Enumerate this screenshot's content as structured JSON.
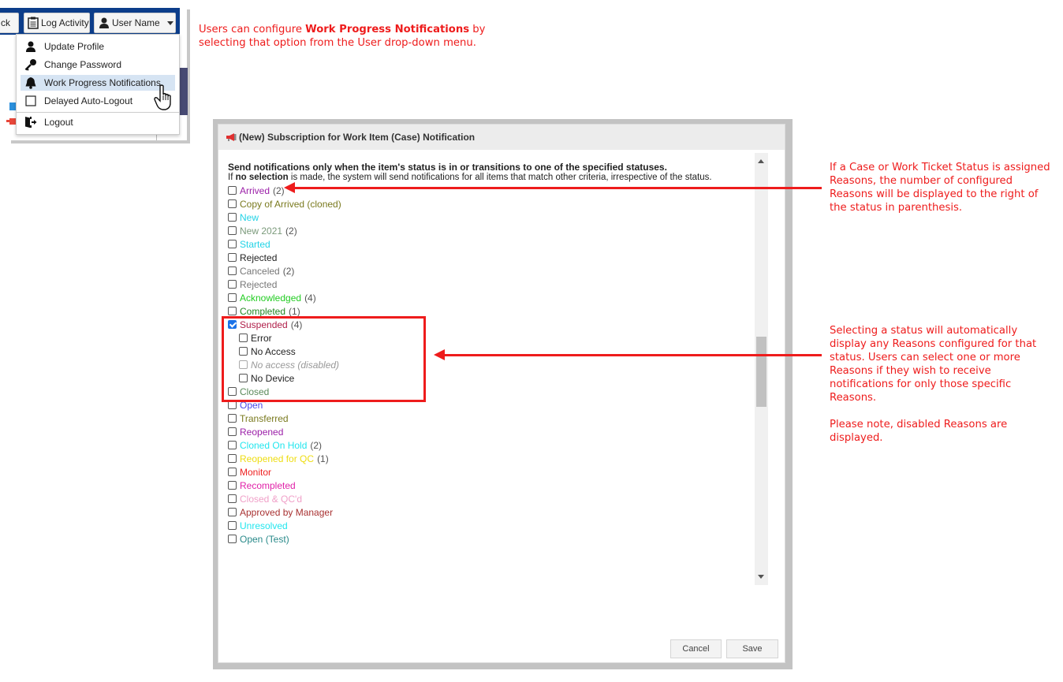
{
  "app": {
    "toolbar": {
      "back_label": "ck",
      "log_activity_label": "Log Activity",
      "user_menu_label": "User Name"
    },
    "user_menu": {
      "items": [
        {
          "label": "Update Profile",
          "icon": "user-icon"
        },
        {
          "label": "Change Password",
          "icon": "key-icon"
        },
        {
          "label": "Work Progress Notifications",
          "icon": "bell-icon",
          "active": true
        },
        {
          "label": "Delayed Auto-Logout",
          "icon": "checkbox-icon"
        },
        {
          "label": "Logout",
          "icon": "logout-icon"
        }
      ]
    }
  },
  "annotations": {
    "note1_pre": "Users can configure ",
    "note1_bold": "Work Progress Notifications",
    "note1_post": " by selecting that option from the User drop-down menu.",
    "note2": "If a Case or Work Ticket Status is assigned Reasons, the number of configured Reasons will be displayed to the right of the status in parenthesis.",
    "note3_p1": "Selecting a status will automatically display any Reasons configured for that status. Users can select one or more Reasons if they wish to receive notifications for only those specific Reasons.",
    "note3_p2": "Please note, disabled Reasons are displayed.",
    "accent_color": "#ee1c1c"
  },
  "dialog": {
    "title": "(New) Subscription for Work Item (Case) Notification",
    "intro_bold": "Send notifications only when the item's status is in or transitions to one of the specified statuses.",
    "intro_pre": "If ",
    "intro_b": "no selection",
    "intro_post": " is made, the system will send notifications for all items that match other criteria, irrespective of the status.",
    "statuses": [
      {
        "label": "Arrived",
        "count": "(2)",
        "color": "#9b1fa8",
        "checked": false
      },
      {
        "label": "Copy of Arrived (cloned)",
        "count": "",
        "color": "#7a7a1f",
        "checked": false
      },
      {
        "label": "New",
        "count": "",
        "color": "#22d3e6",
        "checked": false
      },
      {
        "label": "New 2021",
        "count": "(2)",
        "color": "#7b9a7b",
        "checked": false
      },
      {
        "label": "Started",
        "count": "",
        "color": "#22d3e6",
        "checked": false
      },
      {
        "label": "Rejected",
        "count": "",
        "color": "#222222",
        "checked": false
      },
      {
        "label": "Canceled",
        "count": "(2)",
        "color": "#777777",
        "checked": false
      },
      {
        "label": "Rejected",
        "count": "",
        "color": "#777777",
        "checked": false
      },
      {
        "label": "Acknowledged",
        "count": "(4)",
        "color": "#22cc22",
        "checked": false
      },
      {
        "label": "Completed",
        "count": "(1)",
        "color": "#228822",
        "checked": false
      },
      {
        "label": "Suspended",
        "count": "(4)",
        "color": "#b0204a",
        "checked": true,
        "reasons": [
          {
            "label": "Error",
            "disabled": false,
            "checked": false
          },
          {
            "label": "No Access",
            "disabled": false,
            "checked": false
          },
          {
            "label": "No access (disabled)",
            "disabled": true,
            "checked": false
          },
          {
            "label": "No Device",
            "disabled": false,
            "checked": false
          }
        ]
      },
      {
        "label": "Closed",
        "count": "",
        "color": "#5a8a5a",
        "checked": false
      },
      {
        "label": "Open",
        "count": "",
        "color": "#4a4ae8",
        "checked": false
      },
      {
        "label": "Transferred",
        "count": "",
        "color": "#7a7a1f",
        "checked": false
      },
      {
        "label": "Reopened",
        "count": "",
        "color": "#9b1fa8",
        "checked": false
      },
      {
        "label": "Cloned On Hold",
        "count": "(2)",
        "color": "#22e6ee",
        "checked": false
      },
      {
        "label": "Reopened for QC",
        "count": "(1)",
        "color": "#eedd11",
        "checked": false
      },
      {
        "label": "Monitor",
        "count": "",
        "color": "#ee2222",
        "checked": false
      },
      {
        "label": "Recompleted",
        "count": "",
        "color": "#e022a8",
        "checked": false
      },
      {
        "label": "Closed & QC'd",
        "count": "",
        "color": "#f0a0c8",
        "checked": false
      },
      {
        "label": "Approved by Manager",
        "count": "",
        "color": "#a83232",
        "checked": false
      },
      {
        "label": "Unresolved",
        "count": "",
        "color": "#22e6ee",
        "checked": false
      },
      {
        "label": "Open (Test)",
        "count": "",
        "color": "#2a8a8a",
        "checked": false
      }
    ],
    "cancel_label": "Cancel",
    "save_label": "Save"
  }
}
